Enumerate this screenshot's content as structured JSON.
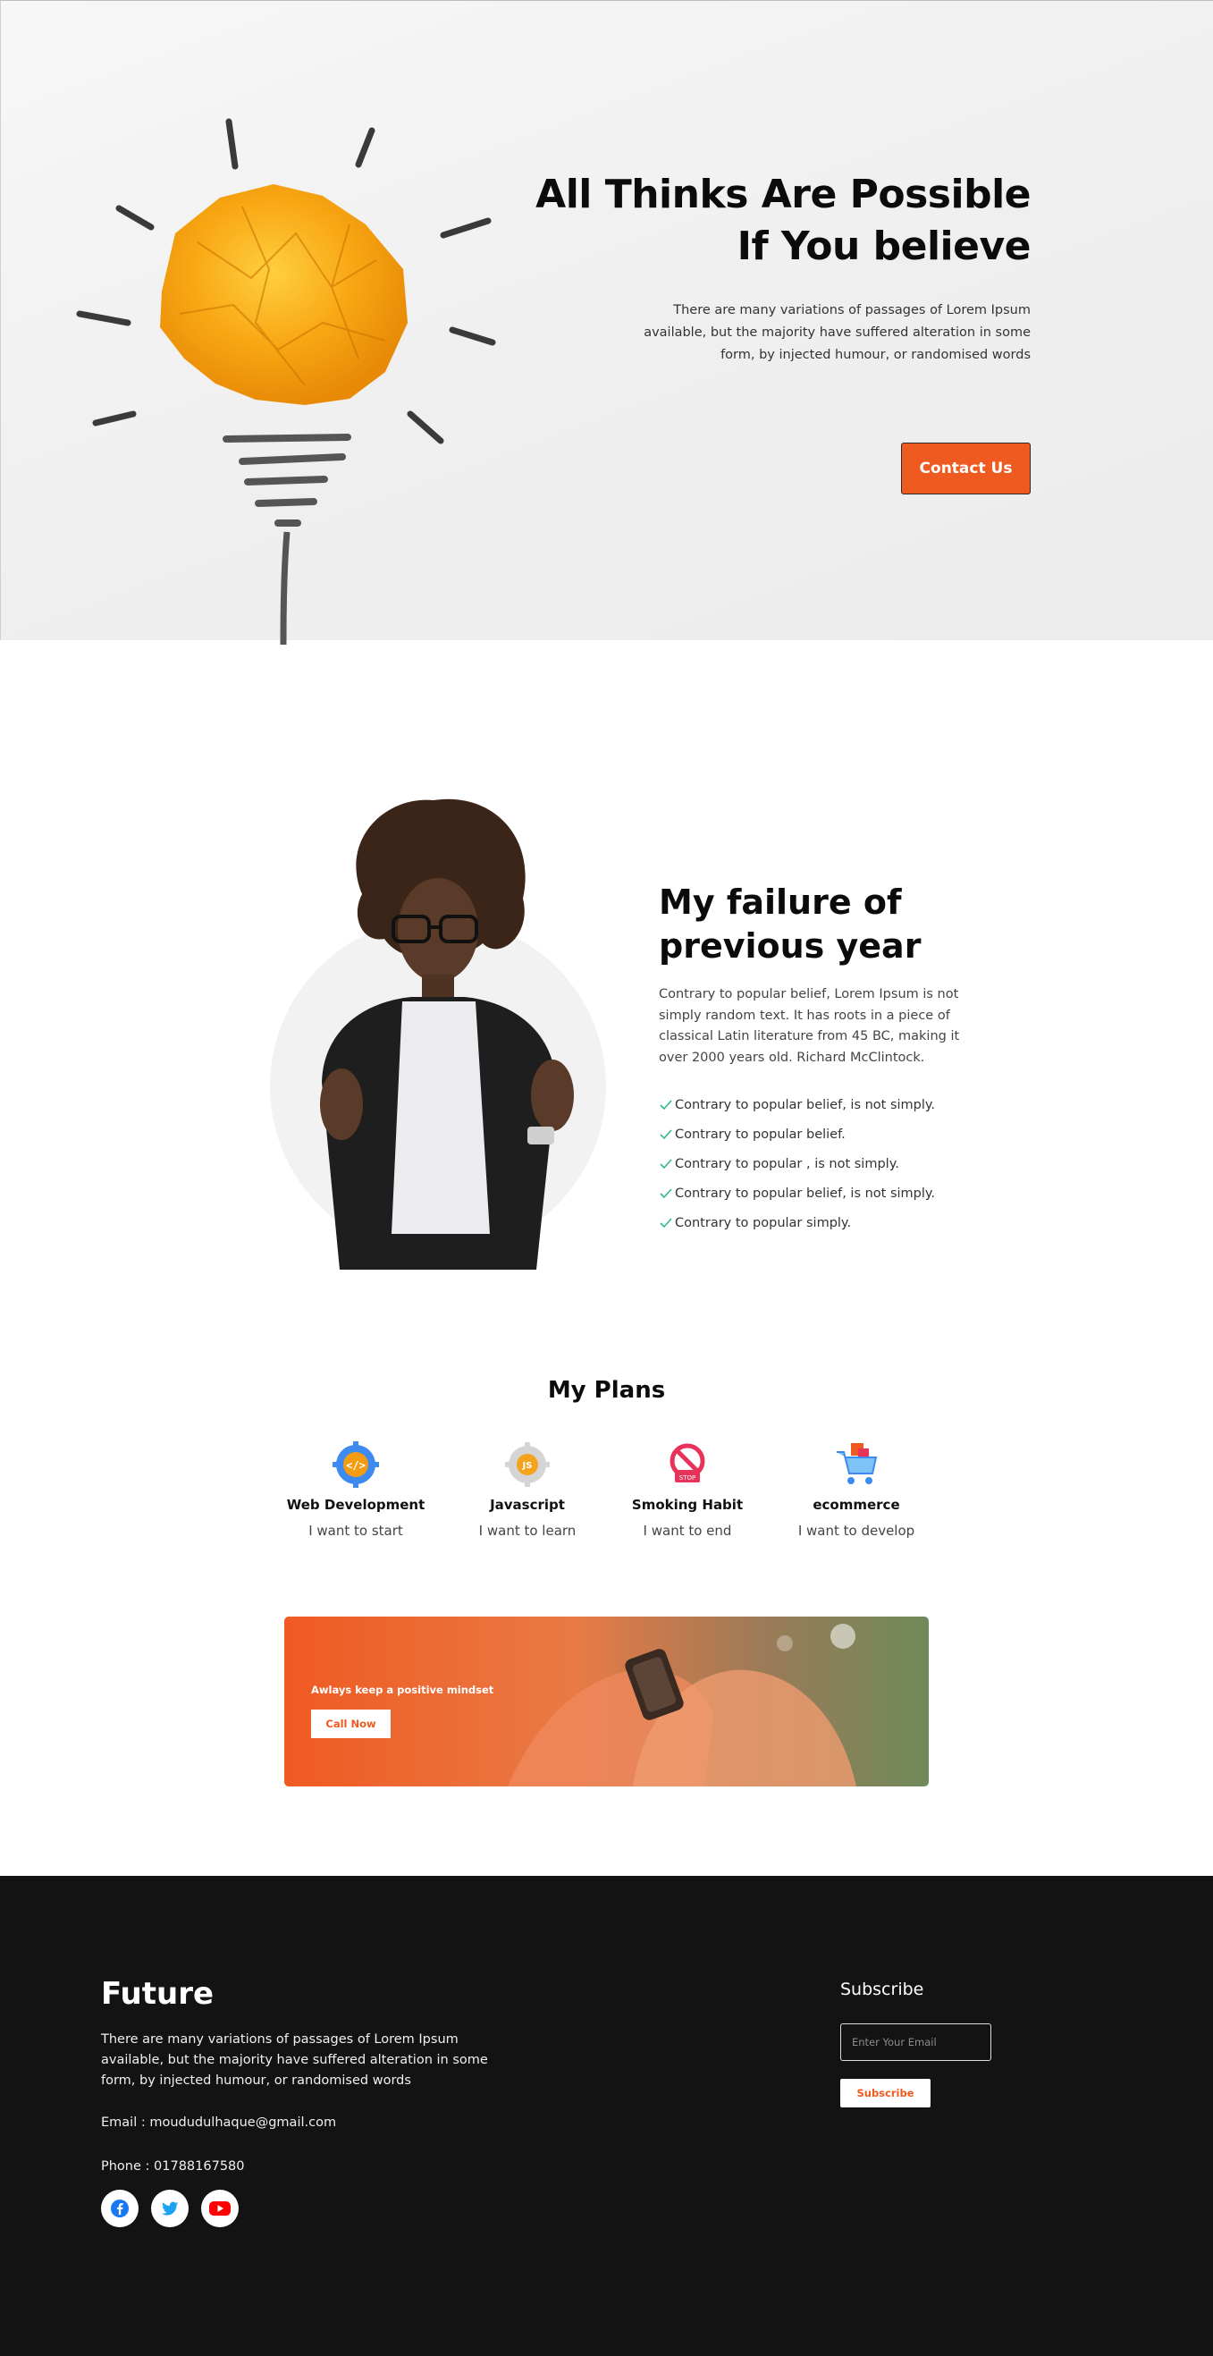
{
  "hero": {
    "title": "All Thinks Are Possible If You believe",
    "description": "There are many variations of passages of Lorem Ipsum available, but the majority have suffered alteration in some form, by injected humour, or randomised words",
    "cta_label": "Contact Us"
  },
  "about": {
    "title": "My failure of previous year",
    "description": "Contrary to popular belief, Lorem Ipsum is not simply random text. It has roots in a piece of classical Latin literature from 45 BC, making it over 2000 years old. Richard McClintock.",
    "checklist": [
      "Contrary to popular belief, is not simply.",
      "Contrary to popular belief.",
      "Contrary to popular , is not simply.",
      "Contrary to popular belief, is not simply.",
      "Contrary to popular simply."
    ]
  },
  "plans": {
    "title": "My Plans",
    "items": [
      {
        "name": "Web Development",
        "subtitle": "I want to start",
        "icon": "web-development-gear-icon"
      },
      {
        "name": "Javascript",
        "subtitle": "I want to learn",
        "icon": "javascript-gear-icon"
      },
      {
        "name": "Smoking Habit",
        "subtitle": "I want to end",
        "icon": "no-smoking-icon"
      },
      {
        "name": "ecommerce",
        "subtitle": "I want to develop",
        "icon": "shopping-cart-icon"
      }
    ]
  },
  "banner": {
    "text": "Awlays keep a positive mindset",
    "button_label": "Call Now"
  },
  "footer": {
    "brand": "Future",
    "description": "There are many variations of passages of Lorem Ipsum available, but the majority have suffered alteration in some form, by injected humour, or randomised words",
    "email": "Email : moududulhaque@gmail.com",
    "phone": "Phone : 01788167580",
    "subscribe_title": "Subscribe",
    "email_placeholder": "Enter Your Email",
    "subscribe_button": "Subscribe",
    "social": [
      "facebook-icon",
      "twitter-icon",
      "youtube-icon"
    ]
  },
  "colors": {
    "accent": "#ef5a20",
    "footer_bg": "#131313",
    "check": "#2fb88b"
  }
}
